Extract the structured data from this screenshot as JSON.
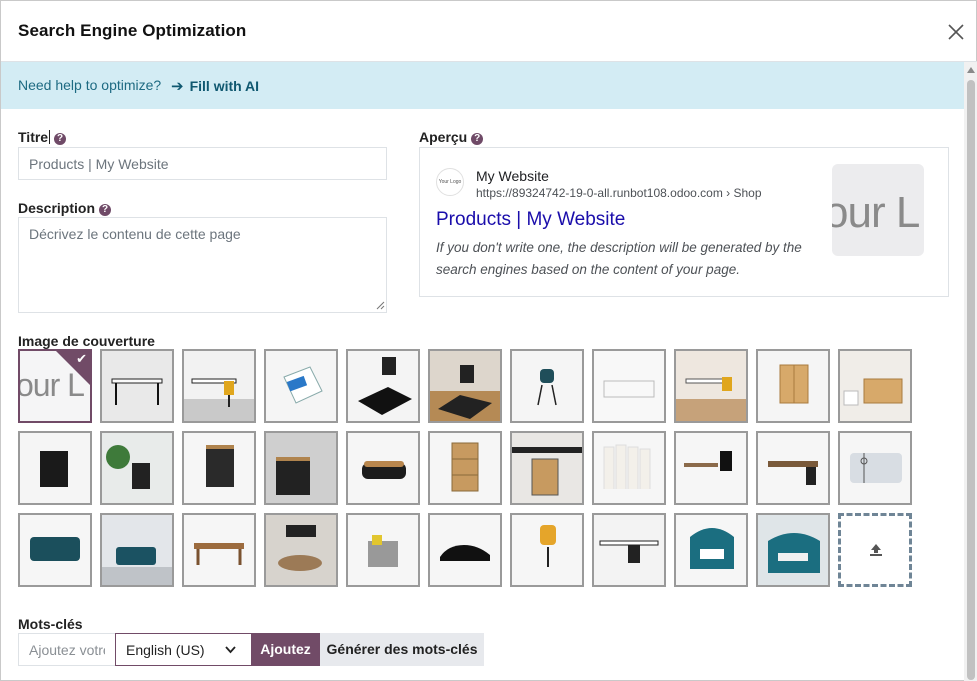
{
  "dialog": {
    "title": "Search Engine Optimization",
    "close_icon": "close-icon"
  },
  "help": {
    "text": "Need help to optimize?",
    "action_label": "Fill with AI",
    "action_icon": "arrow-right-icon"
  },
  "title_field": {
    "label": "Titre",
    "placeholder": "Products | My Website"
  },
  "description_field": {
    "label": "Description",
    "placeholder": "Décrivez le contenu de cette page"
  },
  "preview": {
    "label": "Aperçu",
    "logo_text": "Your Logo",
    "site_name": "My Website",
    "url": "https://89324742-19-0-all.runbot108.odoo.com › Shop",
    "page_title": "Products | My Website",
    "description": "If you don't write one, the description will be generated by the search engines based on the content of your page.",
    "thumb_text": "our L"
  },
  "cover_image": {
    "label": "Image de couverture",
    "selected_text": "our L",
    "images": [
      "logo-placeholder",
      "white-desk",
      "office-desk-chair",
      "software-box",
      "floor-mat-chair",
      "office-chair-mat",
      "teal-chair",
      "glass-desk",
      "white-desk-yellow-chair",
      "wooden-cabinet",
      "wooden-drawer-cabinet",
      "mesh-pencil-cup",
      "pen-holder-plant",
      "black-drawer-unit",
      "black-cabinet-room",
      "cable-box",
      "wooden-drawer-unit",
      "desk-drawer-set",
      "room-divider",
      "black-desk-chair",
      "corner-desk",
      "gift-card",
      "teal-sofa",
      "teal-sofa-room",
      "wooden-desk",
      "conference-table",
      "cleaning-cart",
      "black-car",
      "yellow-office-chair",
      "desk-black-chair",
      "acoustic-booth",
      "acoustic-pod"
    ],
    "upload_icon": "upload-icon"
  },
  "keywords": {
    "label": "Mots-clés",
    "input_placeholder": "Ajoutez votre mot-clé",
    "language": "English (US)",
    "add_label": "Ajoutez",
    "generate_label": "Générer des mots-clés"
  },
  "colors": {
    "brand": "#714b67",
    "banner": "#d3ecf4",
    "link": "#1a0dab"
  }
}
